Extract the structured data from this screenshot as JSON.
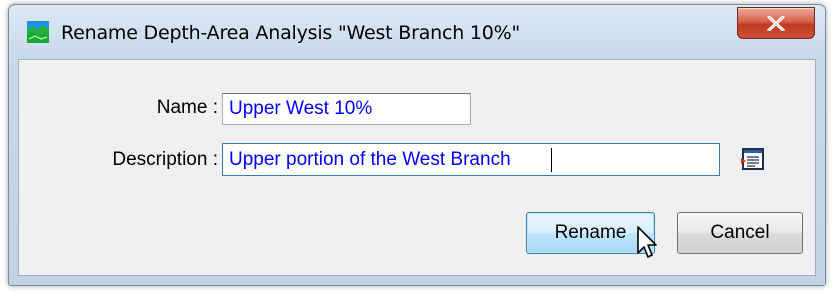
{
  "window": {
    "title": "Rename Depth-Area Analysis \"West Branch 10%\""
  },
  "form": {
    "name_label": "Name :",
    "name_value": "Upper West 10%",
    "description_label": "Description :",
    "description_value": "Upper portion of the West Branch"
  },
  "buttons": {
    "rename_label": "Rename",
    "cancel_label": "Cancel"
  },
  "icons": {
    "app": "depth-area-icon",
    "close": "close-icon",
    "browse": "text-editor-icon",
    "pointer": "mouse-pointer-icon"
  },
  "colors": {
    "field_text": "#0000ff",
    "close_button": "#c2391f",
    "default_button_border": "#3c7fb1"
  }
}
